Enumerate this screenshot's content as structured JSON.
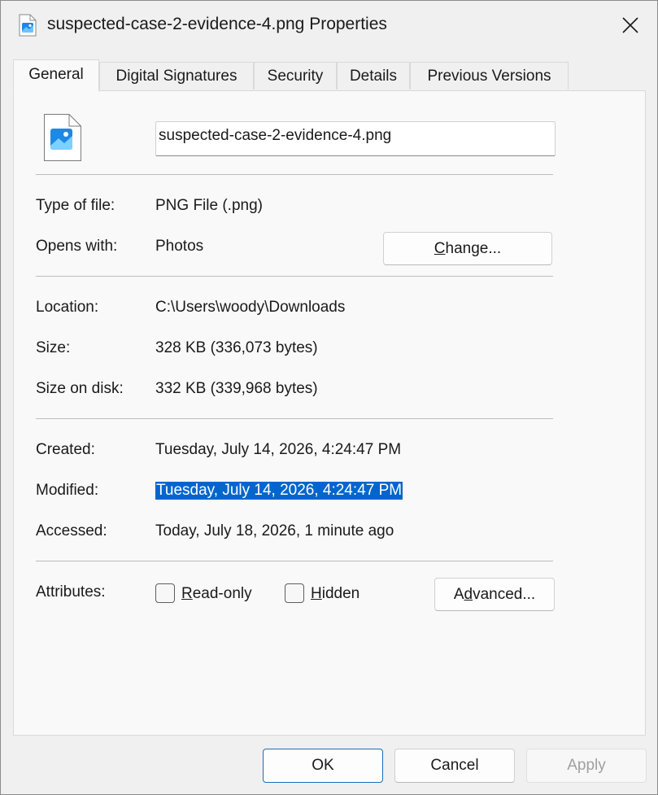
{
  "window": {
    "title": "suspected-case-2-evidence-4.png Properties"
  },
  "tabs": [
    {
      "label": "General"
    },
    {
      "label": "Digital Signatures"
    },
    {
      "label": "Security"
    },
    {
      "label": "Details"
    },
    {
      "label": "Previous Versions"
    }
  ],
  "file": {
    "name": "suspected-case-2-evidence-4.png"
  },
  "info": {
    "type_label": "Type of file:",
    "type_value": "PNG File (.png)",
    "opens_label": "Opens with:",
    "opens_value": "Photos",
    "change_pre": "",
    "change_key": "C",
    "change_post": "hange...",
    "location_label": "Location:",
    "location_value": "C:\\Users\\woody\\Downloads",
    "size_label": "Size:",
    "size_value": "328 KB (336,073 bytes)",
    "size_disk_label": "Size on disk:",
    "size_disk_value": "332 KB (339,968 bytes)",
    "created_label": "Created:",
    "created_value": "Tuesday, July 14, 2026, 4:24:47 PM",
    "modified_label": "Modified:",
    "modified_value": "Tuesday, July 14, 2026, 4:24:47 PM",
    "accessed_label": "Accessed:",
    "accessed_value": "Today, July 18, 2026, 1 minute ago"
  },
  "attributes": {
    "label": "Attributes:",
    "readonly_key": "R",
    "readonly_rest": "ead-only",
    "readonly_checked": false,
    "hidden_key": "H",
    "hidden_rest": "idden",
    "hidden_checked": false,
    "advanced_pre": "A",
    "advanced_key": "d",
    "advanced_post": "vanced..."
  },
  "footer": {
    "ok": "OK",
    "cancel": "Cancel",
    "apply": "Apply"
  },
  "colors": {
    "accent": "#0066cc",
    "icon_blue": "#1e88e5"
  },
  "icons": {
    "title": "image-file-icon",
    "close": "close-icon",
    "file": "image-file-icon"
  }
}
